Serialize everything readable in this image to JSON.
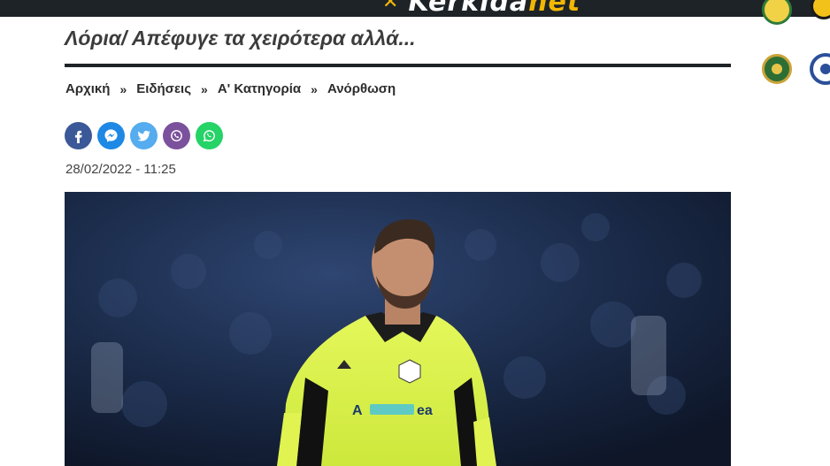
{
  "header": {
    "logo_text_a": "Kerkida",
    "logo_text_b": "net"
  },
  "article": {
    "title": "Λόρια/ Απέφυγε τα χειρότερα αλλά...",
    "date": "28/02/2022 - 11:25",
    "image_sponsor_text": "ea"
  },
  "breadcrumb": {
    "items": [
      "Αρχική",
      "Ειδήσεις",
      "Α' Κατηγορία",
      "Ανόρθωση"
    ],
    "separator": "»"
  },
  "share": [
    {
      "name": "facebook",
      "color": "#3b5998"
    },
    {
      "name": "messenger",
      "color": "#1e88e5"
    },
    {
      "name": "twitter",
      "color": "#55acee"
    },
    {
      "name": "viber",
      "color": "#7b519d"
    },
    {
      "name": "whatsapp",
      "color": "#25d366"
    }
  ],
  "colors": {
    "topbar": "#1e2327",
    "brand_yellow": "#f2b705",
    "jersey": "#dcf24a"
  }
}
